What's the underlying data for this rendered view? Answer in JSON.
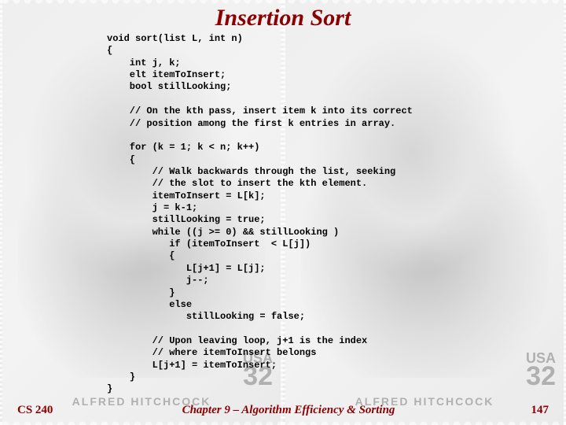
{
  "title": "Insertion Sort",
  "stamp": {
    "name": "ALFRED HITCHCOCK",
    "country": "USA",
    "denom": "32"
  },
  "code": {
    "l01": "void sort(list L, int n)",
    "l02": "{",
    "l03": "    int j, k;",
    "l04": "    elt itemToInsert;",
    "l05": "    bool stillLooking;",
    "l06": "",
    "l07": "    // On the kth pass, insert item k into its correct",
    "l08": "    // position among the first k entries in array.",
    "l09": "",
    "l10": "    for (k = 1; k < n; k++)",
    "l11": "    {",
    "l12": "        // Walk backwards through the list, seeking",
    "l13": "        // the slot to insert the kth element.",
    "l14": "        itemToInsert = L[k];",
    "l15": "        j = k-1;",
    "l16": "        stillLooking = true;",
    "l17": "        while ((j >= 0) && stillLooking )",
    "l18": "           if (itemToInsert  < L[j])",
    "l19": "           {",
    "l20": "              L[j+1] = L[j];",
    "l21": "              j--;",
    "l22": "           }",
    "l23": "           else",
    "l24": "              stillLooking = false;",
    "l25": "",
    "l26": "        // Upon leaving loop, j+1 is the index",
    "l27": "        // where itemToInsert belongs",
    "l28": "        L[j+1] = itemToInsert;",
    "l29": "    }",
    "l30": "}"
  },
  "footer": {
    "course": "CS 240",
    "chapter": "Chapter 9 – Algorithm Efficiency & Sorting",
    "page": "147"
  }
}
